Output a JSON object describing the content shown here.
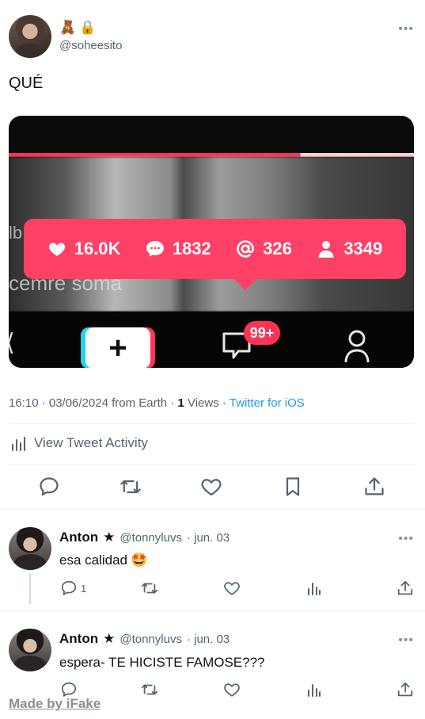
{
  "tweet": {
    "name_emojis": [
      "🧸",
      "🔒"
    ],
    "handle": "@soheesito",
    "text": "QUÉ",
    "media": {
      "stats": {
        "likes": "16.0K",
        "comments": "1832",
        "mentions": "326",
        "followers": "3349"
      },
      "inbox_badge": "99+",
      "overlay_text_line": "cemre soma",
      "overlay_text_edge": "lb"
    },
    "meta": {
      "time_date": "16:10 · 03/06/2024 from Earth · ",
      "views_count": "1",
      "views_label": " Views · ",
      "source": "Twitter for iOS"
    },
    "activity_label": "View Tweet Activity"
  },
  "replies": [
    {
      "name": "Anton",
      "star": "★",
      "handle": "@tonnyluvs",
      "date": "· jun. 03",
      "text": "esa calidad",
      "emoji": "🤩",
      "reply_count": "1"
    },
    {
      "name": "Anton",
      "star": "★",
      "handle": "@tonnyluvs",
      "date": "· jun. 03",
      "text": "espera- TE HICISTE FAMOSE???",
      "emoji": "",
      "reply_count": ""
    }
  ],
  "watermark": "Made by iFake",
  "colors": {
    "link_blue": "#1d9bf0",
    "secondary_text": "#536471",
    "tiktok_pink": "#ff4067"
  }
}
